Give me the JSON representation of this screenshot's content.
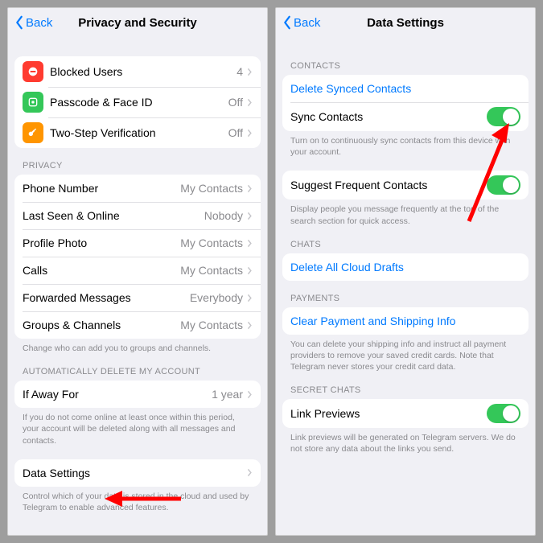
{
  "colors": {
    "accent": "#007aff",
    "toggle_on": "#34c759",
    "arrow": "#ff0000"
  },
  "left": {
    "back": "Back",
    "title": "Privacy and Security",
    "top": [
      {
        "icon": "blocked-icon",
        "bg": "#ff3b30",
        "label": "Blocked Users",
        "value": "4"
      },
      {
        "icon": "passcode-icon",
        "bg": "#34c759",
        "label": "Passcode & Face ID",
        "value": "Off"
      },
      {
        "icon": "key-icon",
        "bg": "#ff9500",
        "label": "Two-Step Verification",
        "value": "Off"
      }
    ],
    "privacy_header": "PRIVACY",
    "privacy": [
      {
        "label": "Phone Number",
        "value": "My Contacts"
      },
      {
        "label": "Last Seen & Online",
        "value": "Nobody"
      },
      {
        "label": "Profile Photo",
        "value": "My Contacts"
      },
      {
        "label": "Calls",
        "value": "My Contacts"
      },
      {
        "label": "Forwarded Messages",
        "value": "Everybody"
      },
      {
        "label": "Groups & Channels",
        "value": "My Contacts"
      }
    ],
    "privacy_footer": "Change who can add you to groups and channels.",
    "auto_header": "AUTOMATICALLY DELETE MY ACCOUNT",
    "auto_row": {
      "label": "If Away For",
      "value": "1 year"
    },
    "auto_footer": "If you do not come online at least once within this period, your account will be deleted along with all messages and contacts.",
    "data_row": "Data Settings",
    "data_footer": "Control which of your data is stored in the cloud and used by Telegram to enable advanced features."
  },
  "right": {
    "back": "Back",
    "title": "Data Settings",
    "contacts_header": "CONTACTS",
    "delete_contacts": "Delete Synced Contacts",
    "sync_label": "Sync Contacts",
    "sync_footer": "Turn on to continuously sync contacts from this device with your account.",
    "suggest_label": "Suggest Frequent Contacts",
    "suggest_footer": "Display people you message frequently at the top of the search section for quick access.",
    "chats_header": "CHATS",
    "delete_drafts": "Delete All Cloud Drafts",
    "payments_header": "PAYMENTS",
    "clear_payment": "Clear Payment and Shipping Info",
    "payments_footer": "You can delete your shipping info and instruct all payment providers to remove your saved credit cards. Note that Telegram never stores your credit card data.",
    "secret_header": "SECRET CHATS",
    "link_previews": "Link Previews",
    "link_footer": "Link previews will be generated on Telegram servers. We do not store any data about the links you send."
  }
}
